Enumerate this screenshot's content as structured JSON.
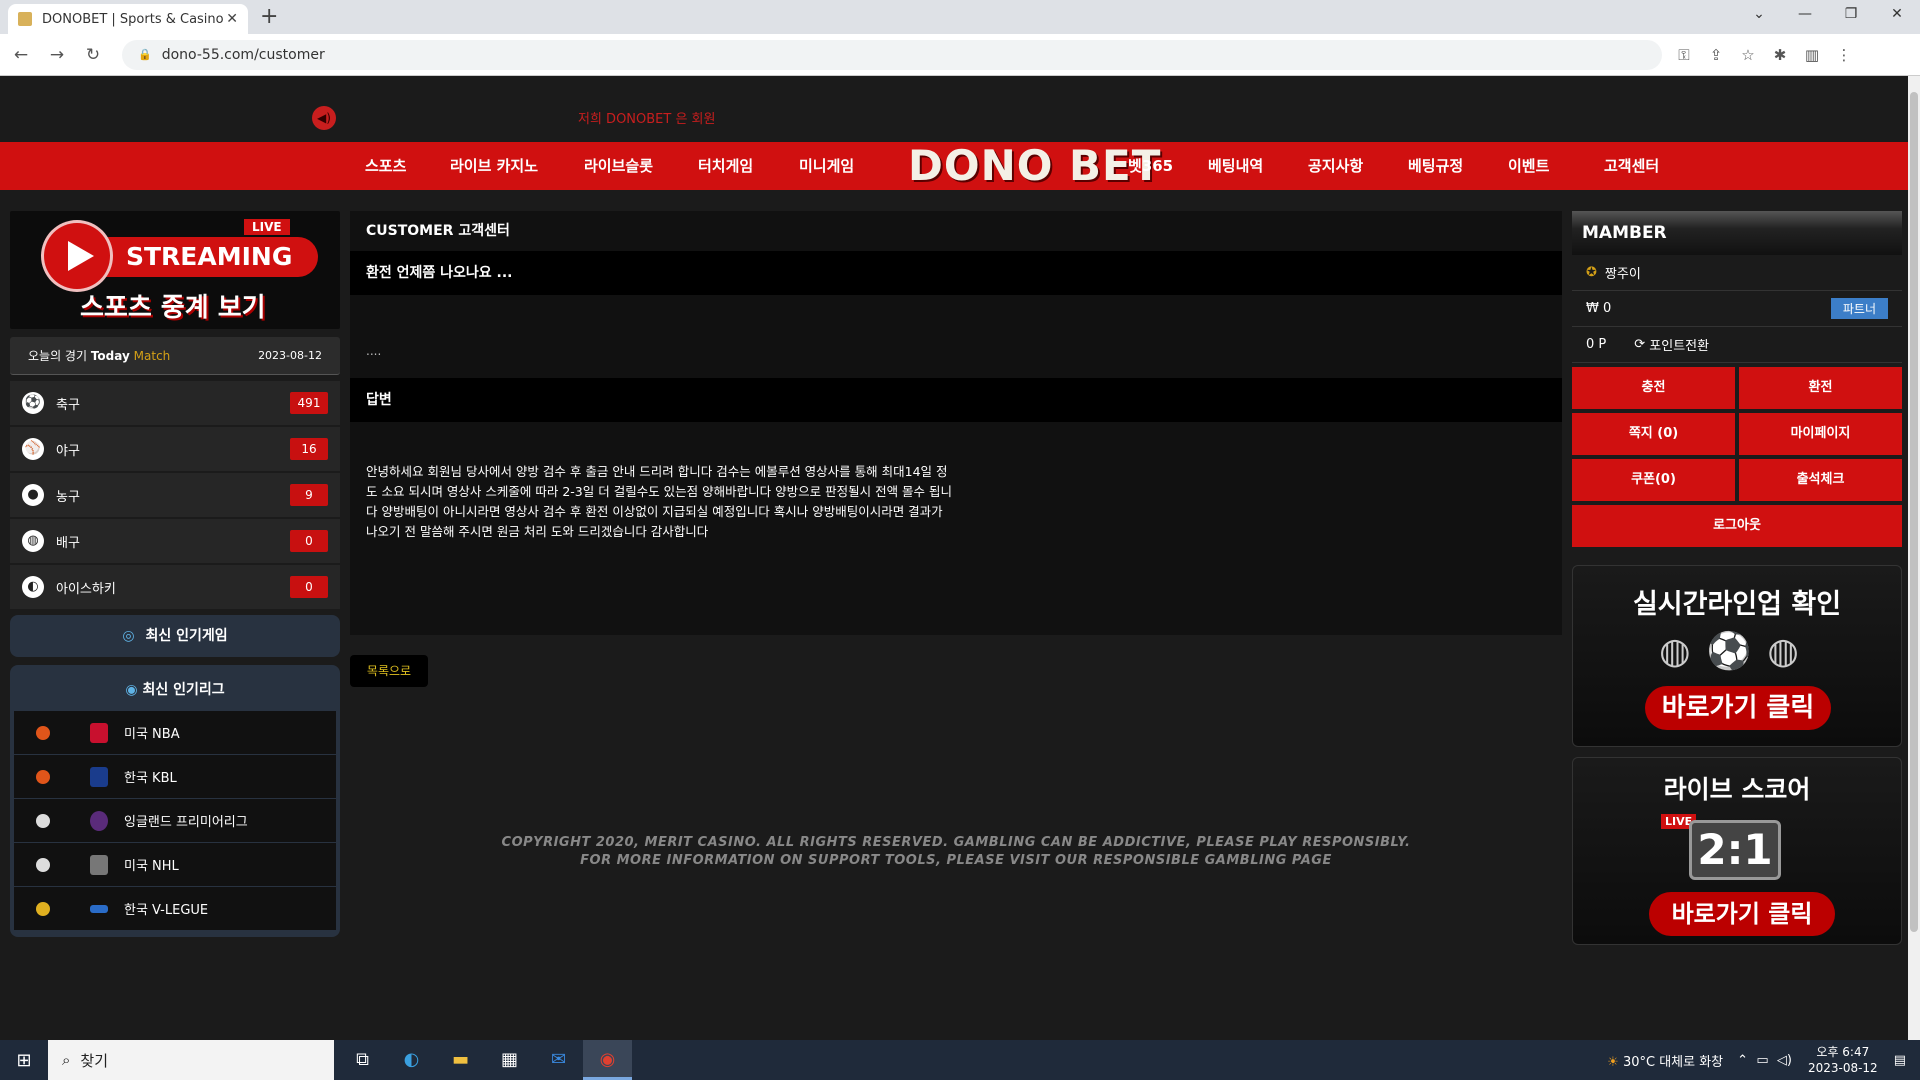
{
  "browser": {
    "tab_title": "DONOBET | Sports & Casino",
    "tab_close": "✕",
    "new_tab": "+",
    "url": "dono-55.com/customer",
    "win_controls": [
      "⌄",
      "—",
      "❐",
      "✕"
    ]
  },
  "header": {
    "ticker": "저희 DONOBET 은 회원",
    "logo": "DONO BET",
    "nav_left": [
      "스포츠",
      "라이브 카지노",
      "라이브슬롯",
      "터치게임",
      "미니게임"
    ],
    "nav_right": [
      "벳365",
      "베팅내역",
      "공지사항",
      "베팅규정",
      "이벤트",
      "고객센터"
    ]
  },
  "left": {
    "stream_live": "LIVE",
    "stream_title": "STREAMING",
    "stream_sub": "스포츠 중계 보기",
    "today_label": "오늘의 경기",
    "today_en": "Today",
    "today_match": "Match",
    "today_date": "2023-08-12",
    "sports": [
      {
        "name": "축구",
        "count": "491",
        "icon": "soccer-ball-icon"
      },
      {
        "name": "야구",
        "count": "16",
        "icon": "baseball-icon"
      },
      {
        "name": "농구",
        "count": "9",
        "icon": "basketball-icon"
      },
      {
        "name": "배구",
        "count": "0",
        "icon": "volleyball-icon"
      },
      {
        "name": "아이스하키",
        "count": "0",
        "icon": "hockey-icon"
      }
    ],
    "popular_games": "최신 인기게임",
    "popular_leagues": "최신 인기리그",
    "leagues": [
      {
        "name": "미국 NBA",
        "color": "#e0551a"
      },
      {
        "name": "한국 KBL",
        "color": "#e0551a"
      },
      {
        "name": "잉글랜드 프리미어리그",
        "color": "#dddddd"
      },
      {
        "name": "미국 NHL",
        "color": "#dddddd"
      },
      {
        "name": "한국 V-LEGUE",
        "color": "#e0b020"
      }
    ]
  },
  "center": {
    "section_title": "CUSTOMER 고객센터",
    "question_title": "환전 언제쯤 나오나요 ...",
    "question_body": "....",
    "answer_label": "답변",
    "answer_body": "안녕하세요 회원님 당사에서 양방 검수 후 출금 안내 드리려 합니다 검수는 에볼루션 영상사를 통해 최대14일 정도 소요 되시며 영상사 스케줄에 따라 2-3일 더 걸릴수도 있는점 양해바랍니다 양방으로 판정될시 전액 몰수 됩니다 양방배팅이 아니시라면 영상사 검수 후 환전 이상없이 지급되실 예정입니다 혹시나 양방배팅이시라면 결과가 나오기 전 말씀해 주시면 원금 처리 도와 드리겠습니다 감사합니다",
    "back_button": "목록으로",
    "footer_line1": "COPYRIGHT 2020, MERIT CASINO. ALL RIGHTS RESERVED. GAMBLING CAN BE ADDICTIVE, PLEASE PLAY RESPONSIBLY.",
    "footer_line2": "FOR MORE INFORMATION ON SUPPORT TOOLS, PLEASE VISIT OUR RESPONSIBLE GAMBLING PAGE"
  },
  "right": {
    "member_title": "MAMBER",
    "username": "짱주이",
    "balance": "₩ 0",
    "partner": "파트너",
    "points": "0 P",
    "point_convert": "포인트전환",
    "buttons": [
      "충전",
      "환전",
      "쪽지 (0)",
      "마이페이지",
      "쿠폰(0)",
      "출석체크"
    ],
    "logout": "로그아웃",
    "banner1_title": "실시간라인업 확인",
    "banner1_cta": "바로가기 클릭",
    "banner2_title": "라이브 스코어",
    "banner2_live": "LIVE",
    "banner2_score": "2:1",
    "banner2_cta": "바로가기 클릭"
  },
  "taskbar": {
    "search_placeholder": "찾기",
    "weather": "30°C 대체로 화창",
    "time": "오후 6:47",
    "date": "2023-08-12"
  }
}
